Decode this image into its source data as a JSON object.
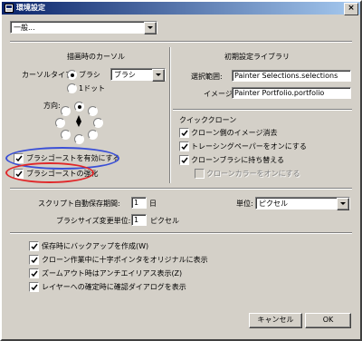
{
  "window": {
    "title": "環境設定",
    "close_symbol": "×"
  },
  "preset": {
    "value": "一般..."
  },
  "cursor_section": {
    "title": "描画時のカーソル",
    "type_label": "カーソルタイプ:",
    "radio_brush_label": "ブラシ",
    "radio_1dot_label": "1ドット",
    "brush_select_value": "ブラシ",
    "direction_label": "方向:",
    "ghost_enable_label": "ブラシゴーストを有効にする",
    "ghost_enhance_label": "ブラシゴーストの強化"
  },
  "library_section": {
    "title": "初期設定ライブラリ",
    "selection_label": "選択範囲:",
    "selection_value": "Painter Selections.selections",
    "image_label": "イメージ:",
    "image_value": "Painter Portfolio.portfolio"
  },
  "clone_section": {
    "title": "クイッククローン",
    "opt1": "クローン側のイメージ消去",
    "opt2": "トレーシングペーパーをオンにする",
    "opt3": "クローンブラシに持ち替える",
    "opt4": "クローンカラーをオンにする"
  },
  "misc": {
    "autosave_label": "スクリプト自動保存期間:",
    "autosave_value": "1",
    "autosave_unit": "日",
    "brushsize_label": "ブラシサイズ変更単位:",
    "brushsize_value": "1",
    "brushsize_unit": "ピクセル",
    "units_label": "単位:",
    "units_value": "ピクセル"
  },
  "options": {
    "backup": "保存時にバックアップを作成(W)",
    "crosshair": "クローン作業中に十字ポインタをオリジナルに表示",
    "antialias": "ズームアウト時はアンチエイリアス表示(Z)",
    "layer_confirm": "レイヤーへの確定時に確認ダイアログを表示"
  },
  "buttons": {
    "cancel": "キャンセル",
    "ok": "OK"
  },
  "highlights": {
    "blue": "#3a4fd6",
    "red": "#e0282a"
  }
}
